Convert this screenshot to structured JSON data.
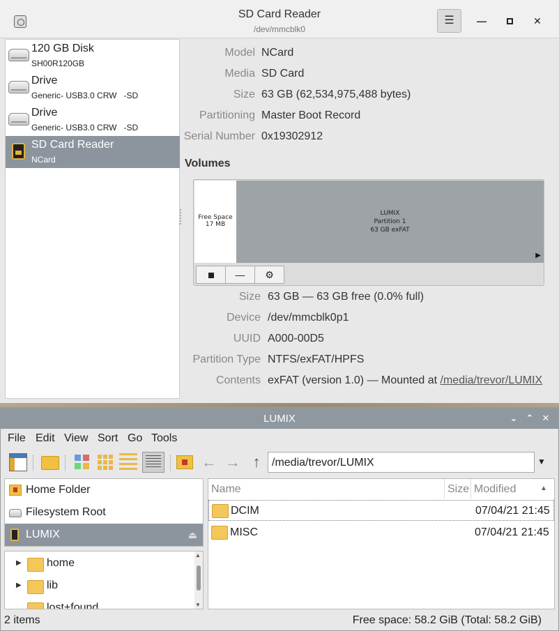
{
  "disks": {
    "title": "SD Card Reader",
    "subtitle": "/dev/mmcblk0",
    "drives": [
      {
        "name": "120 GB Disk",
        "sub": "SH00R120GB"
      },
      {
        "name": "Drive",
        "sub": "Generic- USB3.0 CRW   -SD"
      },
      {
        "name": "Drive",
        "sub": "Generic- USB3.0 CRW   -SD"
      },
      {
        "name": "SD Card Reader",
        "sub": "NCard"
      }
    ],
    "props": {
      "model_label": "Model",
      "model": "NCard",
      "media_label": "Media",
      "media": "SD Card",
      "size_label": "Size",
      "size": "63 GB (62,534,975,488 bytes)",
      "partitioning_label": "Partitioning",
      "partitioning": "Master Boot Record",
      "serial_label": "Serial Number",
      "serial": "0x19302912"
    },
    "volumes_title": "Volumes",
    "volume_map": {
      "free_line1": "Free Space",
      "free_line2": "17 MB",
      "part_line1": "LUMIX",
      "part_line2": "Partition 1",
      "part_line3": "63 GB exFAT"
    },
    "volume_props": {
      "size_label": "Size",
      "size": "63 GB — 63 GB free (0.0% full)",
      "device_label": "Device",
      "device": "/dev/mmcblk0p1",
      "uuid_label": "UUID",
      "uuid": "A000-00D5",
      "ptype_label": "Partition Type",
      "ptype": "NTFS/exFAT/HPFS",
      "contents_label": "Contents",
      "contents_prefix": "exFAT (version 1.0) — Mounted at ",
      "mount_link": "/media/trevor/LUMIX"
    }
  },
  "fm": {
    "title": "LUMIX",
    "menus": [
      "File",
      "Edit",
      "View",
      "Sort",
      "Go",
      "Tools"
    ],
    "path": "/media/trevor/LUMIX",
    "places": [
      "Home Folder",
      "Filesystem Root",
      "LUMIX"
    ],
    "tree": [
      "home",
      "lib",
      "lost+found"
    ],
    "columns": {
      "name": "Name",
      "size": "Size",
      "modified": "Modified"
    },
    "files": [
      {
        "name": "DCIM",
        "modified": "07/04/21 21:45"
      },
      {
        "name": "MISC",
        "modified": "07/04/21 21:45"
      }
    ],
    "status_left": "2 items",
    "status_right": "Free space: 58.2 GiB (Total: 58.2 GiB)"
  }
}
